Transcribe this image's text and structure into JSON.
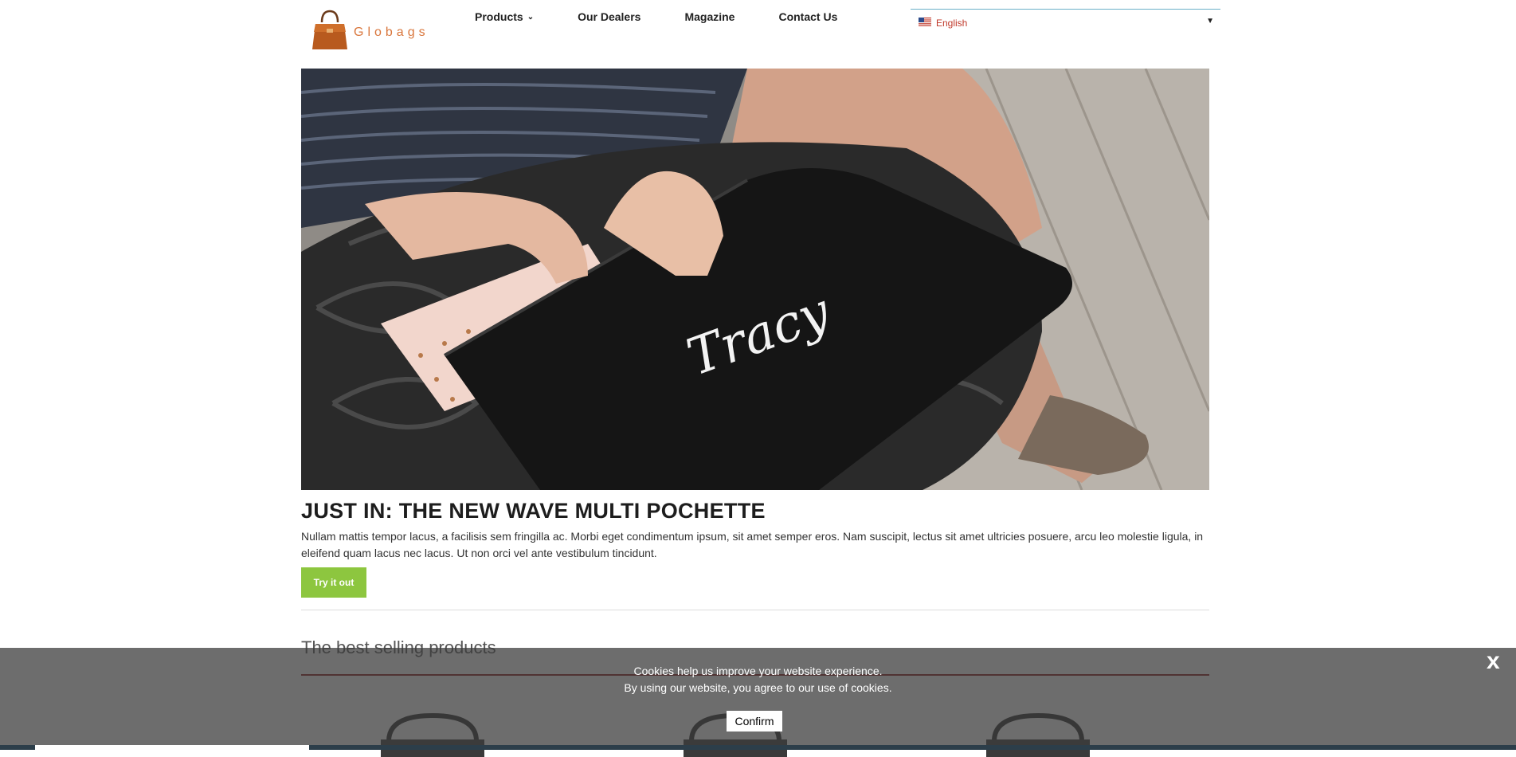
{
  "brand": {
    "name": "Globags",
    "accent": "#d9763c"
  },
  "nav": {
    "items": [
      {
        "label": "Products",
        "has_dropdown": true
      },
      {
        "label": "Our Dealers"
      },
      {
        "label": "Magazine"
      },
      {
        "label": "Contact Us"
      }
    ]
  },
  "language": {
    "selected": "English",
    "flag": "us-flag-icon"
  },
  "hero": {
    "image": "woman-holding-black-pochette-photo",
    "embroidery": "Tracy"
  },
  "article": {
    "title": "JUST IN: THE NEW WAVE MULTI POCHETTE",
    "body": "Nullam mattis tempor lacus, a facilisis sem fringilla ac. Morbi eget condimentum ipsum, sit amet semper eros. Nam suscipit, lectus sit amet ultricies posuere, arcu leo molestie ligula, in eleifend quam lacus nec lacus. Ut non orci vel ante vestibulum tincidunt.",
    "cta_label": "Try it out",
    "cta_color": "#8dc63f"
  },
  "best_selling": {
    "title": "The best selling products",
    "rule_color": "#8b1a1a"
  },
  "cookie_banner": {
    "line1": "Cookies help us improve your website experience.",
    "line2": "By using our website, you agree to our use of cookies.",
    "confirm_label": "Confirm",
    "close_label": "x"
  }
}
